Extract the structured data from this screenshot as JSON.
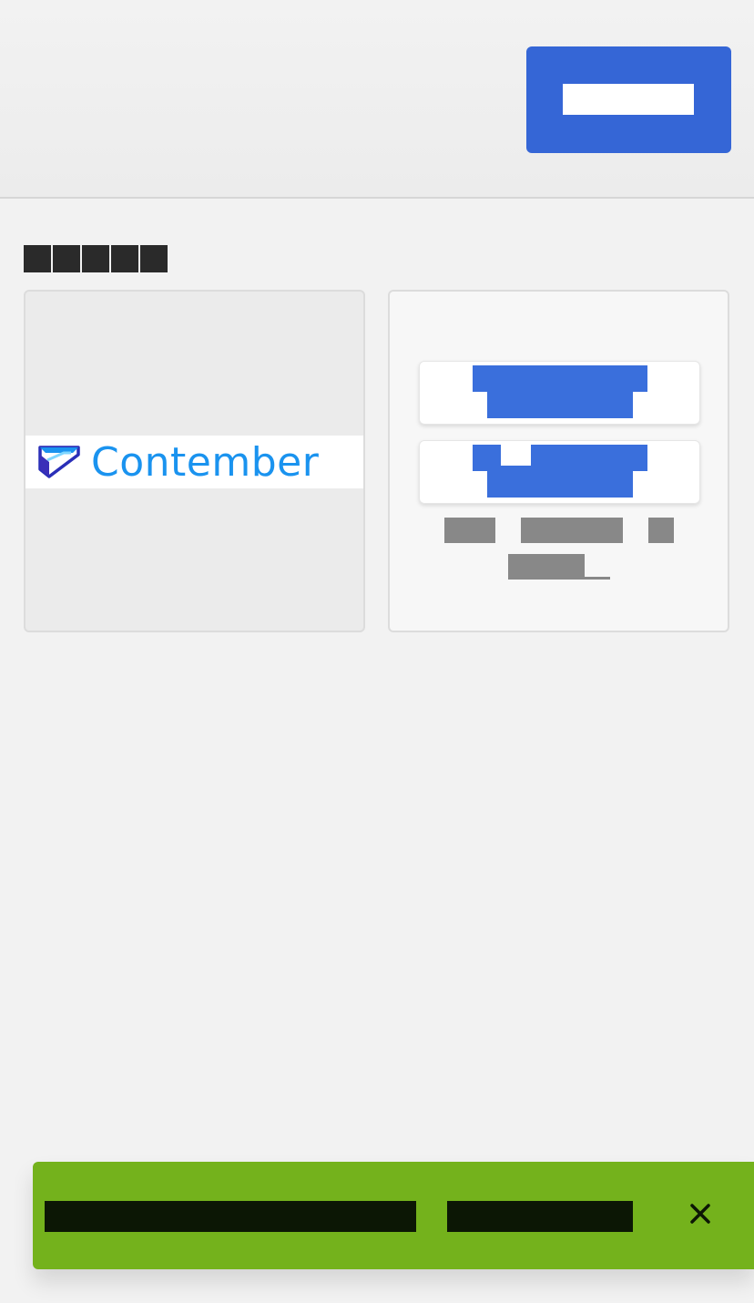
{
  "header": {
    "button_label": ""
  },
  "section": {
    "title": ""
  },
  "logo_card": {
    "brand_name": "Contember"
  },
  "actions_card": {
    "button_1_label": "",
    "button_2_label": "",
    "note": ""
  },
  "toast": {
    "message": "",
    "action": "",
    "close_icon": "close-icon"
  },
  "colors": {
    "primary": "#3566d6",
    "brand_text": "#1a93ef",
    "toast_bg": "#74b21c",
    "background": "#f2f2f2"
  }
}
